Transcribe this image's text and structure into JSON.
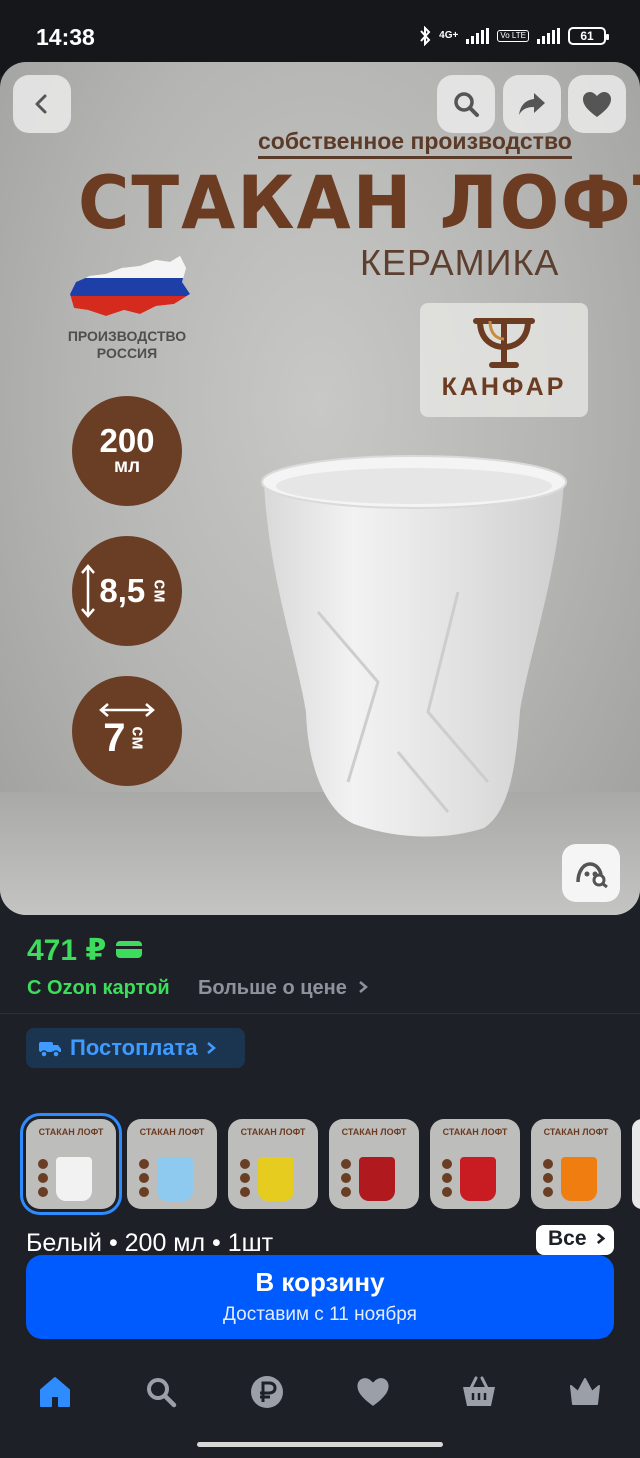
{
  "status_bar": {
    "time": "14:38",
    "network_label": "4G+",
    "volte_label": "Vo LTE",
    "battery": "61",
    "icons": [
      "bluetooth-icon",
      "signal-icon",
      "battery-icon"
    ]
  },
  "hero": {
    "subtitle": "собственное производство",
    "title": "СТАКАН ЛОФТ",
    "material": "КЕРАМИКА",
    "origin_line1": "ПРОИЗВОДСТВО",
    "origin_line2": "РОССИЯ",
    "brand": "КАНФАР",
    "specs": [
      {
        "value": "200",
        "unit": "мл"
      },
      {
        "value": "8,5",
        "unit": "см"
      },
      {
        "value": "7",
        "unit": "см"
      }
    ],
    "buttons": [
      "back-icon",
      "search-icon",
      "share-icon",
      "heart-icon"
    ]
  },
  "price": {
    "amount": "471 ₽",
    "ozon_card_label": "С Ozon картой",
    "more_label": "Больше о цене",
    "postpay_label": "Постоплата"
  },
  "variants": {
    "thumb_title": "СТАКАН ЛОФТ",
    "items": [
      {
        "color": "#f2f2f2",
        "selected": true
      },
      {
        "color": "#8ecaf0",
        "selected": false
      },
      {
        "color": "#e6cc1e",
        "selected": false
      },
      {
        "color": "#b01a1f",
        "selected": false
      },
      {
        "color": "#c81c22",
        "selected": false
      },
      {
        "color": "#ef7d10",
        "selected": false
      }
    ],
    "selected_text": "Белый • 200 мл • 1шт",
    "all_label": "Все"
  },
  "cart": {
    "title": "В корзину",
    "subtitle": "Доставим с 11 ноября"
  },
  "colors": {
    "accent_blue": "#005bff",
    "price_green": "#3ddc5c",
    "brand_brown": "#6a3e24"
  },
  "nav": [
    "home-icon",
    "search-icon",
    "ruble-icon",
    "heart-icon",
    "basket-icon",
    "crown-icon"
  ]
}
